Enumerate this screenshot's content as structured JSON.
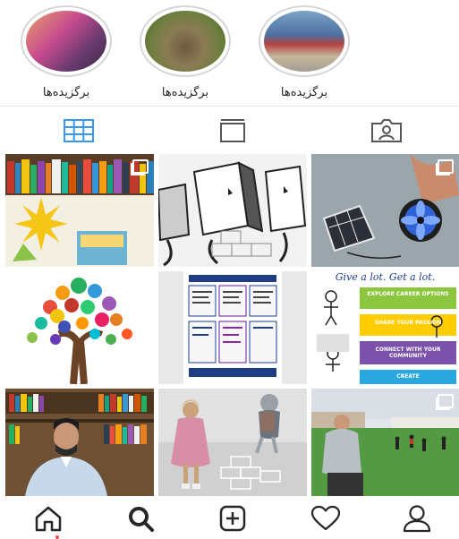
{
  "highlights": [
    {
      "label": "برگزیده‌ها"
    },
    {
      "label": "برگزیده‌ها"
    },
    {
      "label": "برگزیده‌ها"
    }
  ],
  "tabs": [
    {
      "icon": "grid-icon",
      "active": true
    },
    {
      "icon": "igtv-icon",
      "active": false
    },
    {
      "icon": "tagged-icon",
      "active": false
    }
  ],
  "posts": {
    "row3_col2_banner": {
      "title": "Give a lot.  Get a lot.",
      "rows": [
        "EXPLORE CAREER OPTIONS",
        "SHARE YOUR PASSION",
        "CONNECT WITH YOUR COMMUNITY",
        "CREATE"
      ]
    }
  },
  "nav": [
    {
      "icon": "home-icon"
    },
    {
      "icon": "search-icon"
    },
    {
      "icon": "new-post-icon"
    },
    {
      "icon": "activity-heart-icon"
    },
    {
      "icon": "profile-icon"
    }
  ],
  "colors": {
    "active_tab": "#3897f0",
    "icon": "#262626",
    "notification_dot": "#ed4956"
  }
}
